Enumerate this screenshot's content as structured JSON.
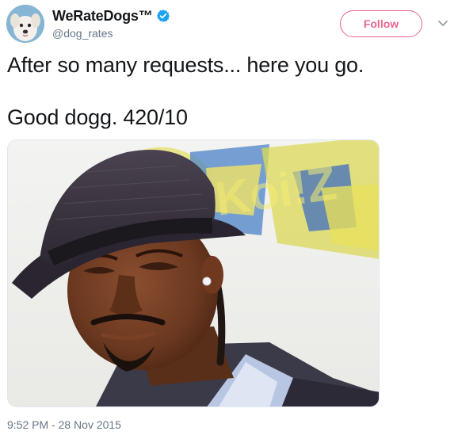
{
  "author": {
    "display_name": "WeRateDogs™",
    "handle": "@dog_rates",
    "verified": true,
    "avatar": "dog-avatar"
  },
  "follow_button": {
    "label": "Follow"
  },
  "menu": {
    "icon": "chevron-down-icon"
  },
  "tweet": {
    "lines": [
      "After so many requests... here you go.",
      "Good dogg. 420/10"
    ]
  },
  "media": {
    "description": "photo",
    "banner_text": "Koi!Z"
  },
  "timestamp": "9:52 PM - 28 Nov 2015",
  "colors": {
    "follow_accent": "#e0245e",
    "verified_blue": "#1da1f2",
    "secondary_text": "#657786",
    "primary_text": "#14171a"
  }
}
